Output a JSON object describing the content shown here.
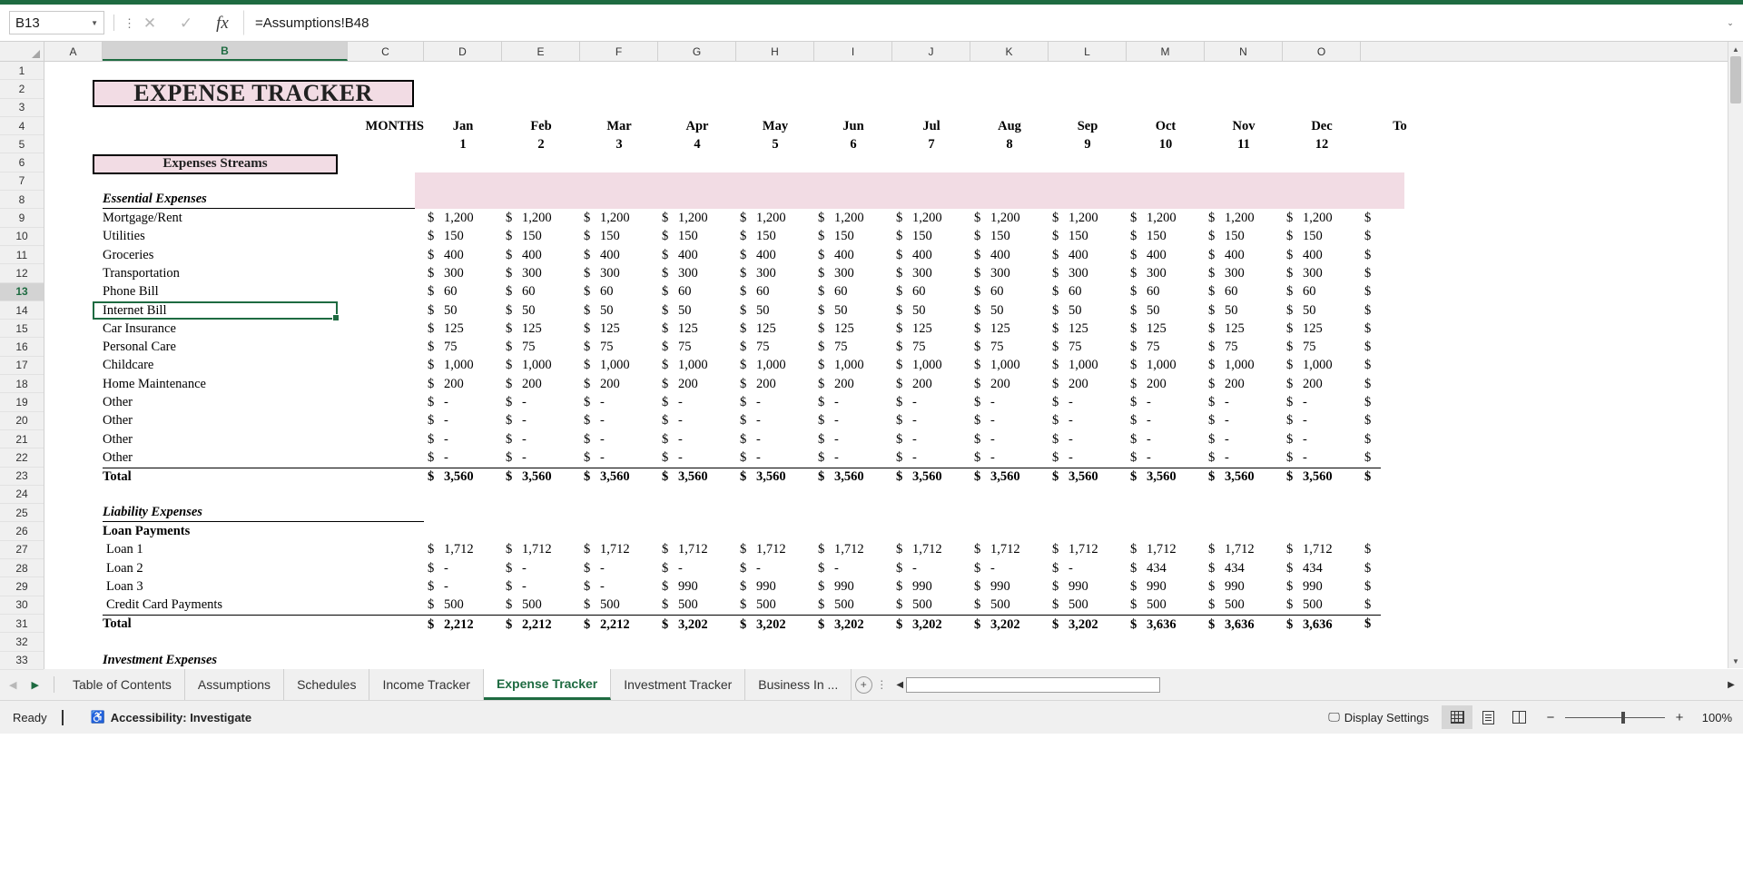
{
  "app": {
    "name_box_value": "B13",
    "formula_value": "=Assumptions!B48",
    "cancel_icon": "close-icon",
    "confirm_icon": "check-icon",
    "function_icon": "fx-icon",
    "expand_icon": "chevron-down-icon"
  },
  "grid": {
    "column_letters": [
      "A",
      "B",
      "C",
      "D",
      "E",
      "F",
      "G",
      "H",
      "I",
      "J",
      "K",
      "L",
      "M",
      "N",
      "O"
    ],
    "selected_column": "B",
    "row_numbers": [
      "1",
      "2",
      "3",
      "4",
      "5",
      "6",
      "7",
      "8",
      "9",
      "10",
      "11",
      "12",
      "13",
      "14",
      "15",
      "16",
      "17",
      "18",
      "19",
      "20",
      "21",
      "22",
      "23",
      "24",
      "25",
      "26",
      "27",
      "28",
      "29",
      "30",
      "31",
      "32",
      "33"
    ],
    "selected_row": "13"
  },
  "sheet": {
    "title": "EXPENSE TRACKER",
    "streams_header": "Expenses Streams",
    "months_label": "MONTHS",
    "months": [
      "Jan",
      "Feb",
      "Mar",
      "Apr",
      "May",
      "Jun",
      "Jul",
      "Aug",
      "Sep",
      "Oct",
      "Nov",
      "Dec"
    ],
    "month_numbers": [
      "1",
      "2",
      "3",
      "4",
      "5",
      "6",
      "7",
      "8",
      "9",
      "10",
      "11",
      "12"
    ],
    "total_col_partial": "To",
    "currency_symbol": "$",
    "dash": "-",
    "sections": {
      "essential": {
        "header": "Essential Expenses",
        "total_label": "Total",
        "rows": [
          {
            "label": "Mortgage/Rent",
            "values": [
              "1,200",
              "1,200",
              "1,200",
              "1,200",
              "1,200",
              "1,200",
              "1,200",
              "1,200",
              "1,200",
              "1,200",
              "1,200",
              "1,200"
            ]
          },
          {
            "label": "Utilities",
            "values": [
              "150",
              "150",
              "150",
              "150",
              "150",
              "150",
              "150",
              "150",
              "150",
              "150",
              "150",
              "150"
            ]
          },
          {
            "label": "Groceries",
            "values": [
              "400",
              "400",
              "400",
              "400",
              "400",
              "400",
              "400",
              "400",
              "400",
              "400",
              "400",
              "400"
            ]
          },
          {
            "label": "Transportation",
            "values": [
              "300",
              "300",
              "300",
              "300",
              "300",
              "300",
              "300",
              "300",
              "300",
              "300",
              "300",
              "300"
            ]
          },
          {
            "label": "Phone Bill",
            "values": [
              "60",
              "60",
              "60",
              "60",
              "60",
              "60",
              "60",
              "60",
              "60",
              "60",
              "60",
              "60"
            ]
          },
          {
            "label": "Internet Bill",
            "values": [
              "50",
              "50",
              "50",
              "50",
              "50",
              "50",
              "50",
              "50",
              "50",
              "50",
              "50",
              "50"
            ]
          },
          {
            "label": "Car Insurance",
            "values": [
              "125",
              "125",
              "125",
              "125",
              "125",
              "125",
              "125",
              "125",
              "125",
              "125",
              "125",
              "125"
            ]
          },
          {
            "label": "Personal Care",
            "values": [
              "75",
              "75",
              "75",
              "75",
              "75",
              "75",
              "75",
              "75",
              "75",
              "75",
              "75",
              "75"
            ]
          },
          {
            "label": "Childcare",
            "values": [
              "1,000",
              "1,000",
              "1,000",
              "1,000",
              "1,000",
              "1,000",
              "1,000",
              "1,000",
              "1,000",
              "1,000",
              "1,000",
              "1,000"
            ]
          },
          {
            "label": "Home Maintenance",
            "values": [
              "200",
              "200",
              "200",
              "200",
              "200",
              "200",
              "200",
              "200",
              "200",
              "200",
              "200",
              "200"
            ]
          },
          {
            "label": "Other",
            "values": [
              "-",
              "-",
              "-",
              "-",
              "-",
              "-",
              "-",
              "-",
              "-",
              "-",
              "-",
              "-"
            ]
          },
          {
            "label": "Other",
            "values": [
              "-",
              "-",
              "-",
              "-",
              "-",
              "-",
              "-",
              "-",
              "-",
              "-",
              "-",
              "-"
            ]
          },
          {
            "label": "Other",
            "values": [
              "-",
              "-",
              "-",
              "-",
              "-",
              "-",
              "-",
              "-",
              "-",
              "-",
              "-",
              "-"
            ]
          },
          {
            "label": "Other",
            "values": [
              "-",
              "-",
              "-",
              "-",
              "-",
              "-",
              "-",
              "-",
              "-",
              "-",
              "-",
              "-"
            ]
          }
        ],
        "totals": [
          "3,560",
          "3,560",
          "3,560",
          "3,560",
          "3,560",
          "3,560",
          "3,560",
          "3,560",
          "3,560",
          "3,560",
          "3,560",
          "3,560"
        ]
      },
      "liability": {
        "header": "Liability Expenses",
        "subheader": "Loan Payments",
        "total_label": "Total",
        "rows": [
          {
            "label": "Loan 1",
            "values": [
              "1,712",
              "1,712",
              "1,712",
              "1,712",
              "1,712",
              "1,712",
              "1,712",
              "1,712",
              "1,712",
              "1,712",
              "1,712",
              "1,712"
            ]
          },
          {
            "label": "Loan 2",
            "values": [
              "-",
              "-",
              "-",
              "-",
              "-",
              "-",
              "-",
              "-",
              "-",
              "434",
              "434",
              "434"
            ]
          },
          {
            "label": "Loan 3",
            "values": [
              "-",
              "-",
              "-",
              "990",
              "990",
              "990",
              "990",
              "990",
              "990",
              "990",
              "990",
              "990"
            ]
          },
          {
            "label": "Credit Card Payments",
            "values": [
              "500",
              "500",
              "500",
              "500",
              "500",
              "500",
              "500",
              "500",
              "500",
              "500",
              "500",
              "500"
            ]
          }
        ],
        "totals": [
          "2,212",
          "2,212",
          "2,212",
          "3,202",
          "3,202",
          "3,202",
          "3,202",
          "3,202",
          "3,202",
          "3,636",
          "3,636",
          "3,636"
        ]
      },
      "investment": {
        "header": "Investment Expenses"
      }
    }
  },
  "tabs": {
    "prev_icon": "chevron-left-icon",
    "next_icon": "chevron-right-icon",
    "items": [
      {
        "label": "Table of Contents",
        "active": false
      },
      {
        "label": "Assumptions",
        "active": false
      },
      {
        "label": "Schedules",
        "active": false
      },
      {
        "label": "Income Tracker",
        "active": false
      },
      {
        "label": "Expense Tracker",
        "active": true
      },
      {
        "label": "Investment Tracker",
        "active": false
      },
      {
        "label": "Business In ...",
        "active": false
      }
    ],
    "add_sheet_label": "+"
  },
  "status": {
    "ready": "Ready",
    "accessibility": "Accessibility: Investigate",
    "display_settings": "Display Settings",
    "zoom": "100%",
    "zoom_minus": "−",
    "zoom_plus": "+",
    "view_normal_icon": "grid-view-icon",
    "view_layout_icon": "page-layout-icon",
    "view_break_icon": "page-break-icon",
    "record_macro_icon": "record-macro-icon",
    "accessibility_icon": "accessibility-icon",
    "display_settings_icon": "display-settings-icon"
  },
  "colors": {
    "accent": "#1e6b41",
    "banner_fill": "#f2dce4",
    "chrome": "#f0f0f0"
  }
}
